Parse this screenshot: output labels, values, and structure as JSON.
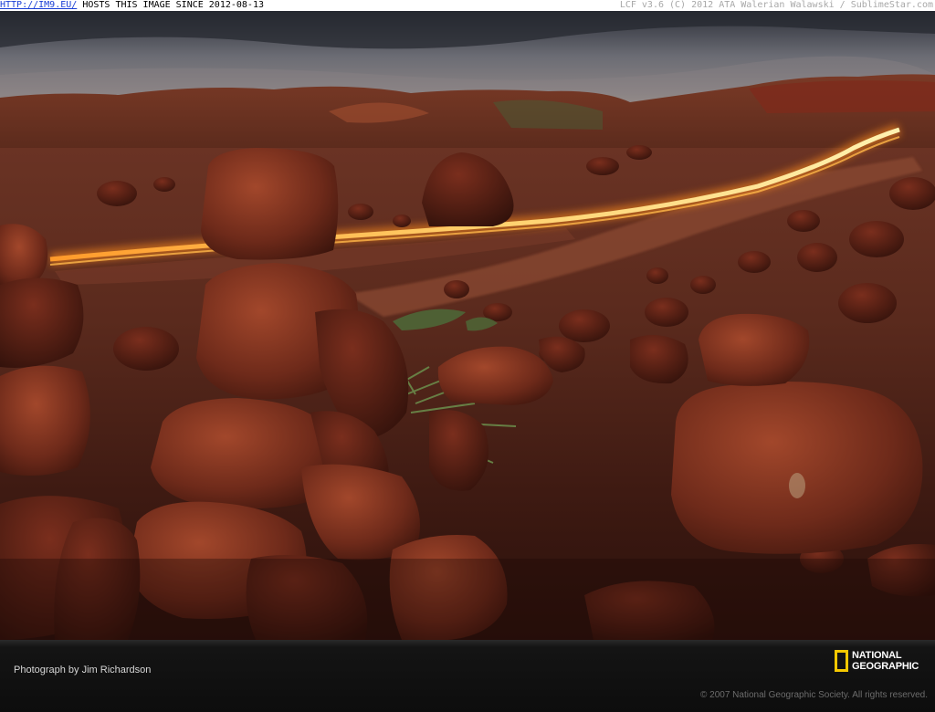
{
  "banner": {
    "link_text": "HTTP://IM9.EU/",
    "hosts_text": " HOSTS THIS IMAGE SINCE 2012-08-13",
    "right_text": "LCF v3.6 (C) 2012 ATA Walerian Walawski / SublimeStar.com"
  },
  "caption": {
    "credit": "Photograph by Jim Richardson",
    "copyright": "© 2007 National Geographic Society. All rights reserved."
  },
  "logo": {
    "line1": "NATIONAL",
    "line2": "GEOGRAPHIC",
    "frame_color": "#f5c800"
  }
}
